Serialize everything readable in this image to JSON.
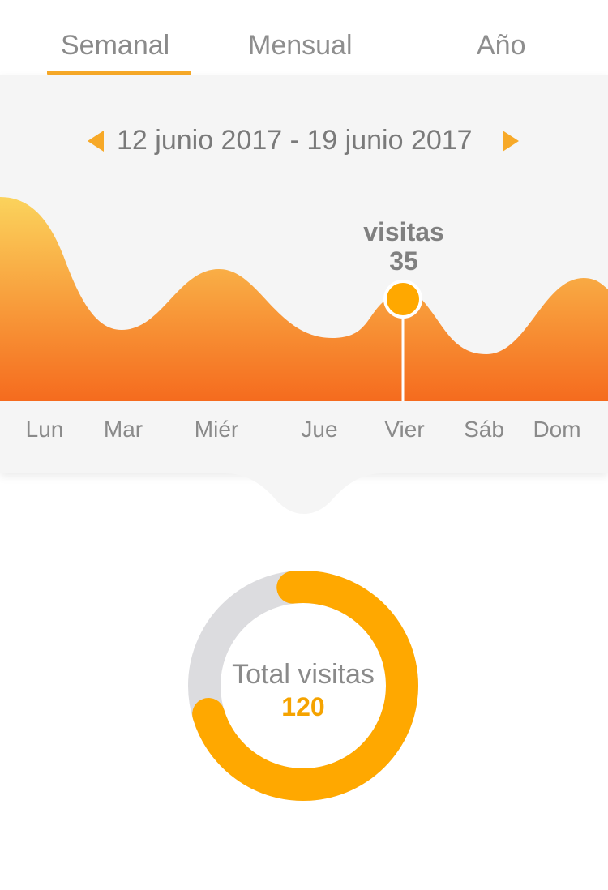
{
  "tabs": [
    {
      "label": "Semanal",
      "active": true
    },
    {
      "label": "Mensual",
      "active": false
    },
    {
      "label": "Año",
      "active": false
    }
  ],
  "date_range": {
    "text": "12 junio 2017 - 19 junio 2017"
  },
  "colors": {
    "accent": "#f7a928",
    "gradient_top": "#fbd35c",
    "gradient_bottom": "#f56b1e",
    "point": "#ffa800",
    "donut_track": "#dcdcdf",
    "donut_fill": "#ffa800"
  },
  "chart_data": {
    "type": "area",
    "categories": [
      "Lun",
      "Mar",
      "Miér",
      "Jue",
      "Vier",
      "Sáb",
      "Dom"
    ],
    "selected_index": 4,
    "tooltip": {
      "label": "visitas",
      "value": "35"
    }
  },
  "total": {
    "label": "Total visitas",
    "value": "120",
    "fraction": 0.72
  }
}
